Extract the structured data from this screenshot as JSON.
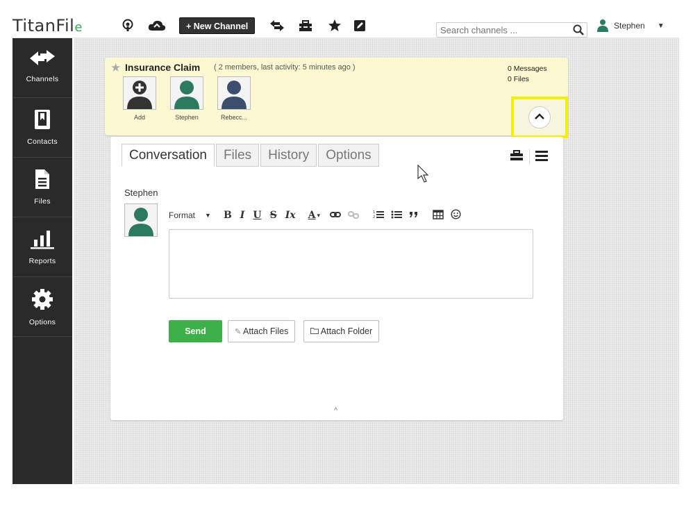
{
  "app": {
    "logo_text": "TitanFil",
    "logo_swirl": "e"
  },
  "topbar": {
    "new_channel_label": "+ New Channel",
    "search_placeholder": "Search channels ...",
    "user_name": "Stephen",
    "icons": [
      "podcast-icon",
      "cloud-upload-icon",
      "exchange-icon",
      "toolbox-icon",
      "star-icon",
      "edit-icon",
      "search-icon",
      "user-icon",
      "caret-down-icon"
    ]
  },
  "sidebar": {
    "items": [
      {
        "label": "Channels",
        "icon": "exchange-icon"
      },
      {
        "label": "Contacts",
        "icon": "contacts-book-icon"
      },
      {
        "label": "Files",
        "icon": "file-icon"
      },
      {
        "label": "Reports",
        "icon": "bar-chart-icon"
      },
      {
        "label": "Options",
        "icon": "gear-icon"
      }
    ]
  },
  "channel": {
    "name": "Insurance Claim",
    "meta": "( 2 members, last activity: 5 minutes ago )",
    "members": [
      {
        "name": "Add"
      },
      {
        "name": "Stephen"
      },
      {
        "name": "Rebecc..."
      }
    ],
    "messages_count": "0",
    "messages_label": "Messages",
    "files_count": "0",
    "files_label": "Files"
  },
  "panel": {
    "tabs": [
      {
        "label": "Conversation",
        "active": true
      },
      {
        "label": "Files",
        "active": false
      },
      {
        "label": "History",
        "active": false
      },
      {
        "label": "Options",
        "active": false
      }
    ],
    "composer_user": "Stephen",
    "toolbar": {
      "format_label": "Format",
      "bold": "B",
      "italic": "I",
      "underline": "U",
      "strike": "S",
      "clear_format": "Ix",
      "text_color": "A"
    },
    "send_label": "Send",
    "attach_files_label": "Attach Files",
    "attach_folder_label": "Attach Folder"
  },
  "colors": {
    "sidebar_bg": "#2a2a2a",
    "header_bg": "#fcf8d2",
    "highlight": "#f3f100",
    "send_green": "#3db049",
    "member_green": "#2c7a5f",
    "member_navy": "#3c4f6e"
  }
}
